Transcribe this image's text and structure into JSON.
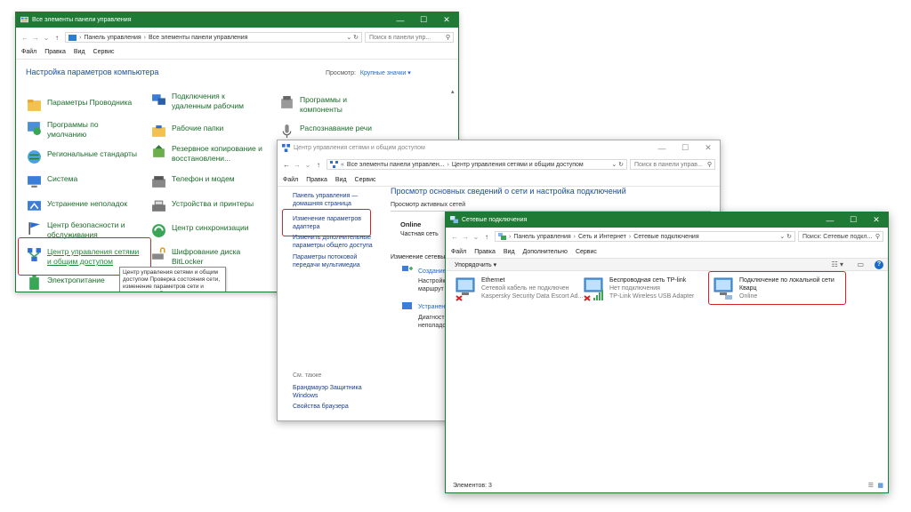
{
  "win1": {
    "title": "Все элементы панели управления",
    "address": [
      "Панель управления",
      "Все элементы панели управления"
    ],
    "search_placeholder": "Поиск в панели упр...",
    "menu": [
      "Файл",
      "Правка",
      "Вид",
      "Сервис"
    ],
    "heading": "Настройка параметров компьютера",
    "view_label": "Просмотр:",
    "view_value": "Крупные значки",
    "items": [
      "Параметры Проводника",
      "Подключения к удаленным рабочим",
      "Программы и компоненты",
      "Программы по умолчанию",
      "Рабочие папки",
      "Распознавание речи",
      "Региональные стандарты",
      "Резервное копирование и восстановлени...",
      "Система",
      "Телефон и модем",
      "Устранение неполадок",
      "Устройства и принтеры",
      "Центр безопасности и обслуживания",
      "Центр синхронизации",
      "Центр управления сетями и общим доступом",
      "Шифрование диска BitLocker",
      "Электропитание"
    ],
    "tooltip": "Центр управления сетями и общим доступом Проверка состояния сети, изменение параметров сети и параметров общего доступа к файлам и принтерам."
  },
  "win2": {
    "title": "Центр управления сетями и общим доступом",
    "address": [
      "Все элементы панели управлен...",
      "Центр управления сетями и общим доступом"
    ],
    "search_placeholder": "Поиск в панели управ...",
    "menu": [
      "Файл",
      "Правка",
      "Вид",
      "Сервис"
    ],
    "sidebar": [
      "Панель управления — домашняя страница",
      "Изменение параметров адаптера",
      "Изменить дополнительные параметры общего доступа",
      "Параметры потоковой передачи мультимедиа"
    ],
    "see_also_label": "См. также",
    "see_also": [
      "Брандмауэр Защитника Windows",
      "Свойства браузера"
    ],
    "main_title": "Просмотр основных сведений о сети и настройка подключений",
    "active_networks": "Просмотр активных сетей",
    "network_name": "Online",
    "network_type": "Частная сеть",
    "change_settings": "Изменение сетевых",
    "task1_link": "Создание",
    "task1_desc": "Настройк маршрут",
    "task2_link": "Устранен",
    "task2_desc": "Диагност неполадо"
  },
  "win3": {
    "title": "Сетевые подключения",
    "address": [
      "Панель управления",
      "Сеть и Интернет",
      "Сетевые подключения"
    ],
    "search_placeholder": "Поиск: Сетевые подкл...",
    "menu": [
      "Файл",
      "Правка",
      "Вид",
      "Дополнительно",
      "Сервис"
    ],
    "organize": "Упорядочить",
    "connections": [
      {
        "name": "Ethernet",
        "status": "Сетевой кабель не подключен",
        "device": "Kaspersky Security Data Escort Ad..."
      },
      {
        "name": "Беспроводная сеть TP-link",
        "status": "Нет подключения",
        "device": "TP-Link Wireless USB Adapter"
      },
      {
        "name": "Подключение по локальной сети Кварц",
        "status": "Online",
        "device": ""
      }
    ],
    "status_bar": "Элементов: 3"
  },
  "colors": {
    "title_green": "#1e7a34",
    "highlight_red": "#d4242a",
    "link_blue": "#1b6ac9"
  }
}
